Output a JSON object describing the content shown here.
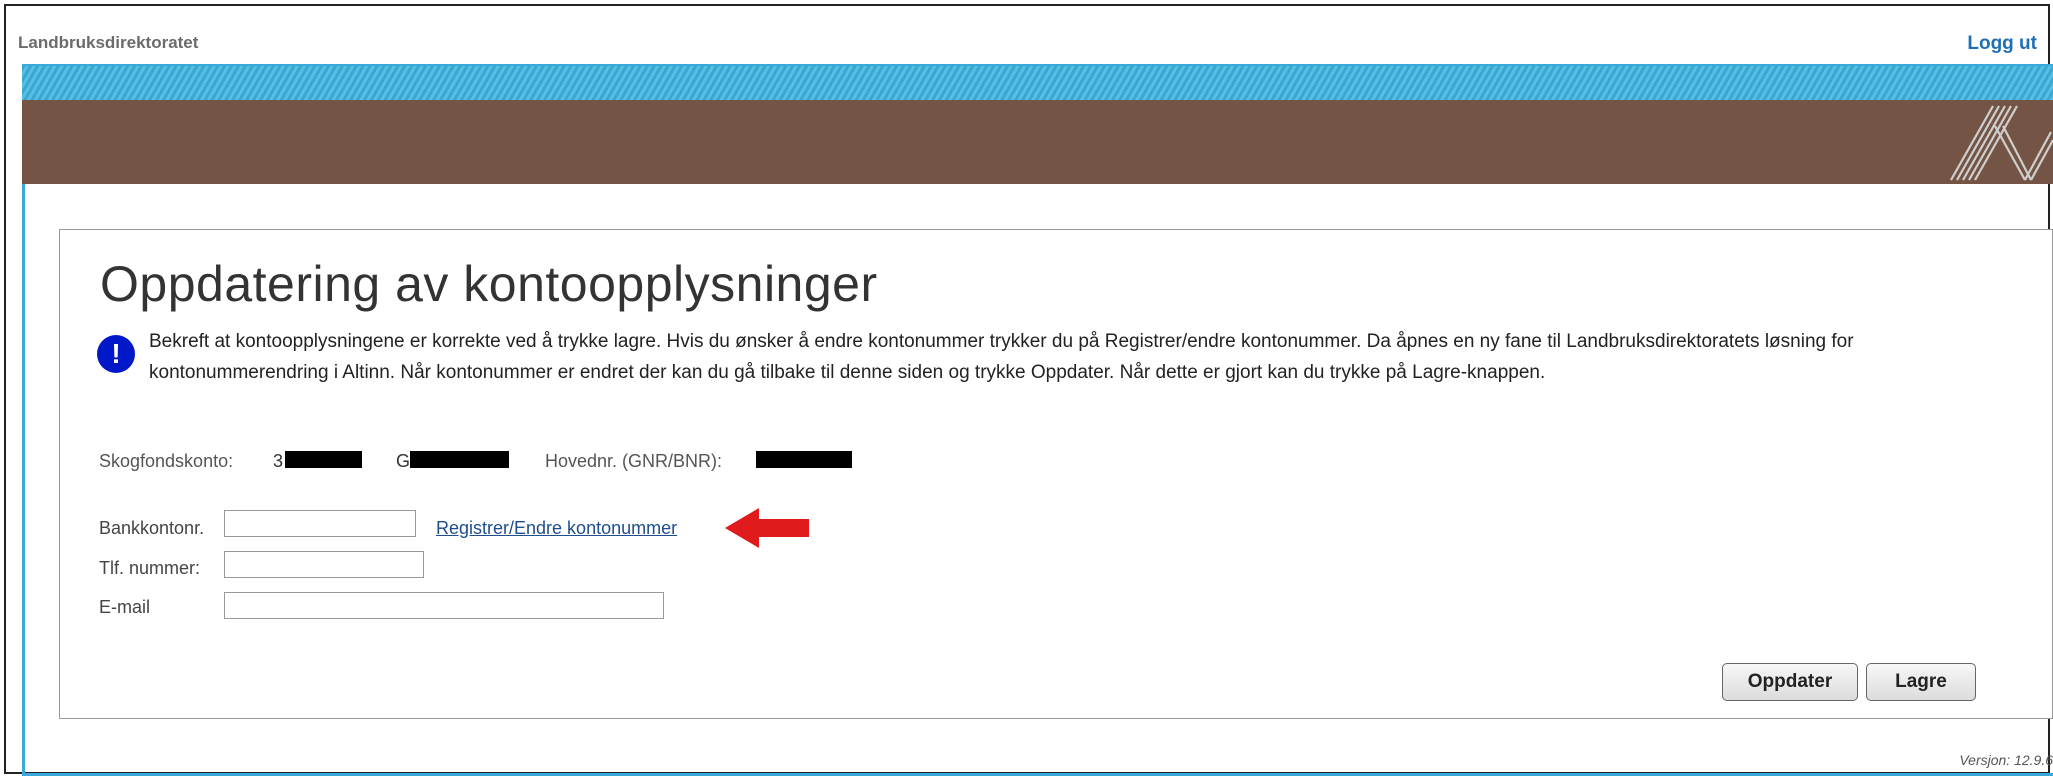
{
  "header": {
    "brand": "Landbruksdirektoratet",
    "logout_label": "Logg ut"
  },
  "colors": {
    "accent_stripe": "#38a9d8",
    "brown_band": "#745444",
    "link": "#1f6fb5",
    "info_icon_bg": "#0018c8",
    "arrow": "#e01b1b"
  },
  "icons": {
    "logo": "landbruk-logo-icon",
    "info": "exclamation-icon",
    "arrow": "red-arrow-left-icon"
  },
  "main": {
    "title": "Oppdatering av kontoopplysninger",
    "info_text": "Bekreft at kontoopplysningene er korrekte ved å trykke lagre. Hvis du ønsker å endre kontonummer trykker du på Registrer/endre kontonummer. Da åpnes en ny fane til Landbruksdirektoratets løsning for kontonummerendring i Altinn. Når kontonummer er endret der kan du gå tilbake til denne siden og trykke Oppdater. Når dette er gjort kan du trykke på Lagre-knappen.",
    "skogfondskonto_label": "Skogfondskonto:",
    "skogfondskonto_prefix": "3",
    "g_prefix": "G",
    "hovednr_label": "Hovednr. (GNR/BNR):",
    "fields": {
      "bank_label": "Bankkontonr.",
      "bank_value": "",
      "tlf_label": "Tlf. nummer:",
      "tlf_value": "",
      "email_label": "E-mail",
      "email_value": ""
    },
    "register_link": "Registrer/Endre kontonummer",
    "buttons": {
      "update": "Oppdater",
      "save": "Lagre"
    }
  },
  "footer": {
    "version": "Versjon: 12.9.6"
  }
}
